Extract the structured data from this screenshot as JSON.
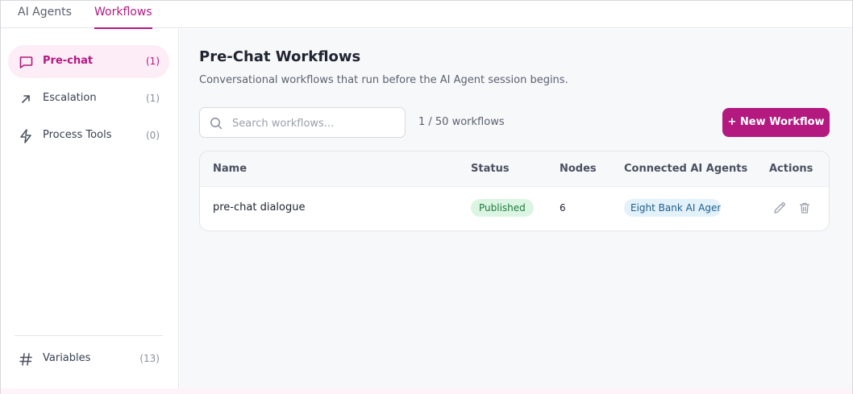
{
  "tabs": [
    {
      "label": "AI Agents",
      "active": false
    },
    {
      "label": "Workflows",
      "active": true
    }
  ],
  "sidebar": {
    "items": [
      {
        "label": "Pre-chat",
        "count": "(1)",
        "icon": "message-square-icon",
        "active": true
      },
      {
        "label": "Escalation",
        "count": "(1)",
        "icon": "arrow-up-right-icon",
        "active": false
      },
      {
        "label": "Process Tools",
        "count": "(0)",
        "icon": "lightning-icon",
        "active": false
      }
    ],
    "footer": {
      "label": "Variables",
      "count": "(13)",
      "icon": "hash-icon"
    }
  },
  "main": {
    "title": "Pre-Chat Workflows",
    "subtitle": "Conversational workflows that run before the AI Agent session begins.",
    "search": {
      "placeholder": "Search workflows...",
      "value": ""
    },
    "count_text": "1 / 50 workflows",
    "new_button": "+ New Workflow",
    "table": {
      "columns": [
        "Name",
        "Status",
        "Nodes",
        "Connected AI Agents",
        "Actions"
      ],
      "rows": [
        {
          "name": "pre-chat dialogue",
          "status": "Published",
          "nodes": "6",
          "agent": "Eight Bank AI Agent"
        }
      ]
    }
  },
  "colors": {
    "accent": "#b3197f",
    "published_bg": "#dcf5e3",
    "agent_bg": "#e3f1fb"
  }
}
